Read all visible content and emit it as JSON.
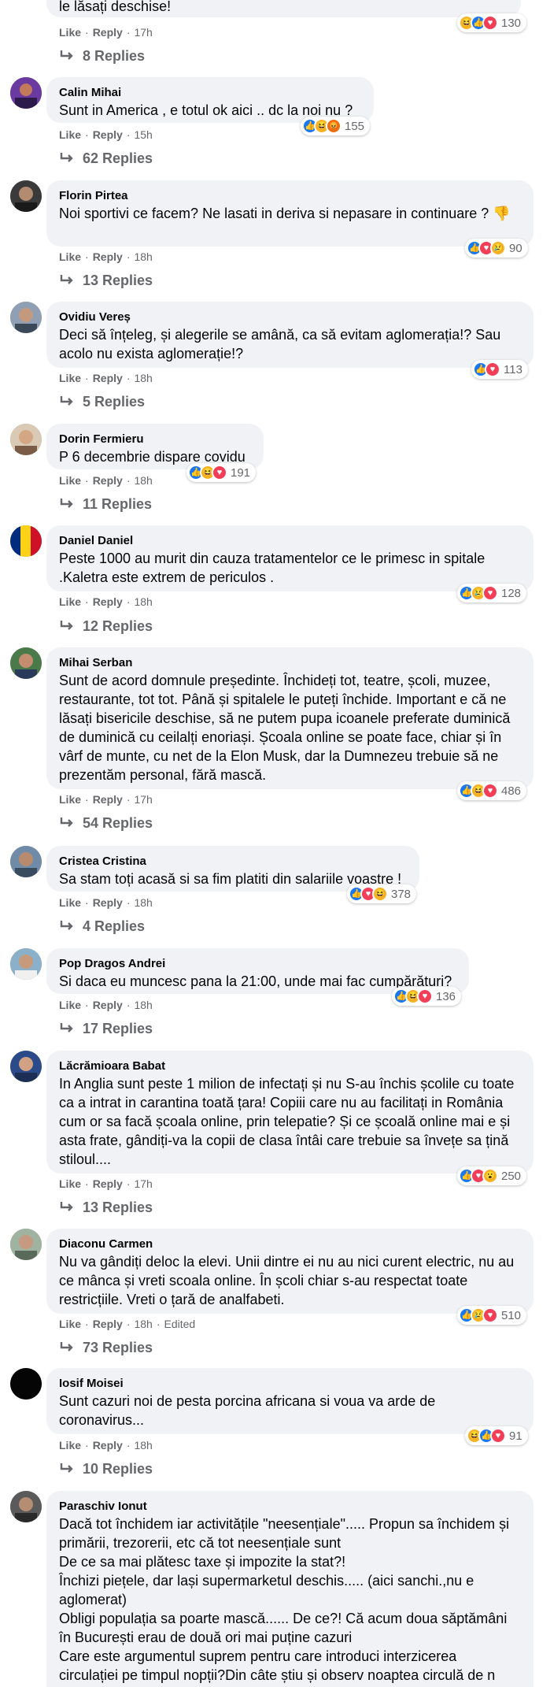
{
  "labels": {
    "like": "Like",
    "reply": "Reply"
  },
  "comments": [
    {
      "author": "",
      "text": "le lăsați deschise!",
      "time": "17h",
      "reaction_count": "130",
      "reactions": [
        "haha",
        "like",
        "love"
      ],
      "replies": "8 Replies"
    },
    {
      "author": "Calin Mihai",
      "text": "Sunt in America , e totul ok aici .. dc la noi nu ?",
      "time": "15h",
      "reaction_count": "155",
      "reactions": [
        "like",
        "haha",
        "angry"
      ],
      "replies": "62 Replies"
    },
    {
      "author": "Florin Pirtea",
      "text": "Noi sportivi ce facem? Ne lasati in deriva si nepasare in continuare ? 👎",
      "time": "18h",
      "reaction_count": "90",
      "reactions": [
        "like",
        "love",
        "sad"
      ],
      "replies": "13 Replies"
    },
    {
      "author": "Ovidiu Vereș",
      "text": "Deci să înțeleg, și alegerile se amână, ca să evitam aglomerația!? Sau acolo nu exista aglomerație!?",
      "time": "18h",
      "reaction_count": "113",
      "reactions": [
        "like",
        "love"
      ],
      "replies": "5 Replies"
    },
    {
      "author": "Dorin Fermieru",
      "text": "P 6 decembrie dispare covidu",
      "time": "18h",
      "reaction_count": "191",
      "reactions": [
        "like",
        "haha",
        "love"
      ],
      "replies": "11 Replies"
    },
    {
      "author": "Daniel Daniel",
      "text": "Peste 1000 au murit din cauza tratamentelor ce le primesc in spitale .Kaletra este extrem de periculos .",
      "time": "18h",
      "reaction_count": "128",
      "reactions": [
        "like",
        "sad",
        "love"
      ],
      "replies": "12 Replies"
    },
    {
      "author": "Mihai Serban",
      "text": "Sunt de acord domnule președinte. Închideți tot, teatre, școli, muzee, restaurante, tot tot. Până și spitalele le puteți închide. Important e că ne lăsați bisericile deschise, să ne putem pupa icoanele preferate duminică de duminică cu ceilalți enoriași. Școala online se poate face, chiar și în vârf de munte, cu net de la Elon Musk, dar la Dumnezeu trebuie să ne prezentăm personal, fără mască.",
      "time": "17h",
      "reaction_count": "486",
      "reactions": [
        "like",
        "haha",
        "love"
      ],
      "replies": "54 Replies"
    },
    {
      "author": "Cristea Cristina",
      "text": "Sa stam toți acasă si sa fim platiti din salariile voastre !",
      "time": "18h",
      "reaction_count": "378",
      "reactions": [
        "like",
        "love",
        "haha"
      ],
      "replies": "4 Replies"
    },
    {
      "author": "Pop Dragos Andrei",
      "text": "Si daca eu muncesc pana la 21:00, unde mai fac cumpărături?",
      "time": "18h",
      "reaction_count": "136",
      "reactions": [
        "like",
        "haha",
        "love"
      ],
      "replies": "17 Replies"
    },
    {
      "author": "Lăcrămioara Babat",
      "text": "In Anglia sunt peste 1 milion de infectați și nu S-au închis școlile cu toate ca a intrat in carantina toată țara! Copiii care nu au facilitați in România cum or sa facă școala online, prin telepatie? Și ce școală online mai e și asta frate, gândiți-va la copii de clasa întâi care trebuie sa învețe sa țină stiloul....",
      "time": "17h",
      "reaction_count": "250",
      "reactions": [
        "like",
        "love",
        "wow"
      ],
      "replies": "13 Replies"
    },
    {
      "author": "Diaconu Carmen",
      "text": "Nu va gândiți deloc la elevi. Unii dintre ei nu au nici curent electric, nu au ce mânca și vreti scoala online. În școli chiar s-au respectat toate restricțiile. Vreti o țară de analfabeti.",
      "time": "18h",
      "edited": "Edited",
      "reaction_count": "510",
      "reactions": [
        "like",
        "sad",
        "love"
      ],
      "replies": "73 Replies"
    },
    {
      "author": "Iosif Moisei",
      "text": "Sunt cazuri noi de pesta porcina africana si voua va arde de coronavirus...",
      "time": "18h",
      "reaction_count": "91",
      "reactions": [
        "haha",
        "like",
        "love"
      ],
      "replies": "10 Replies"
    },
    {
      "author": "Paraschiv Ionut",
      "text_lines": [
        "Dacă tot închidem iar activitățile \"neesențiale\"..... Propun sa închidem și",
        "primării, trezorerii, etc că tot neesențiale sunt",
        "De ce sa mai plătesc taxe și impozite la stat?!",
        "Închizi piețele, dar lași supermarketul deschis..... (aici sanchi.,nu e",
        "aglomerat)",
        "Obligi populația sa poarte mască...... De ce?! Că acum doua săptămâni",
        "în București erau de două ori mai puține cazuri",
        "Care este argumentul suprem pentru care introduci interzicerea",
        "circulației pe timpul nopții?Din câte știu și observ noaptea circulă de n"
      ]
    }
  ]
}
